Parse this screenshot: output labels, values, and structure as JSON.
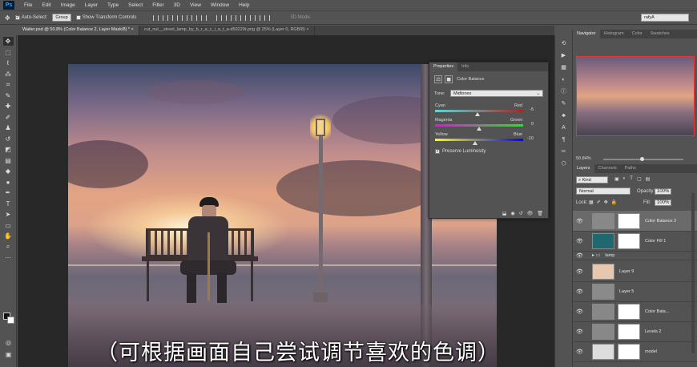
{
  "app": {
    "logo": "Ps"
  },
  "menu": [
    "File",
    "Edit",
    "Image",
    "Layer",
    "Type",
    "Select",
    "Filter",
    "3D",
    "View",
    "Window",
    "Help"
  ],
  "options": {
    "auto_select": "Auto-Select:",
    "group": "Group",
    "transform": "Show Transform Controls",
    "mode3d": "3D Mode:",
    "workspace": "rafyA"
  },
  "tabs": [
    {
      "label": "Waiter.psd @ 50.8% (Color Balance 2, Layer Mask/8) *"
    },
    {
      "label": "cut_out__street_lamp_by_b_r_a_c_i_a_t_a-d59229t.png @ 25% (Layer 0, RGB/8)"
    }
  ],
  "navigator": {
    "tabs": [
      "Navigator",
      "Histogram",
      "Color",
      "Swatches"
    ],
    "zoom": "50.84%"
  },
  "properties": {
    "tabs": [
      "Properties",
      "Info"
    ],
    "title": "Color Balance",
    "tone_label": "Tone:",
    "tone_value": "Midtones",
    "sliders": [
      {
        "left": "Cyan",
        "right": "Red",
        "value": "-5",
        "pos": 0.48
      },
      {
        "left": "Magenta",
        "right": "Green",
        "value": "0",
        "pos": 0.5
      },
      {
        "left": "Yellow",
        "right": "Blue",
        "value": "-10",
        "pos": 0.45
      }
    ],
    "preserve": "Preserve Luminosity"
  },
  "layers": {
    "tabs": [
      "Layers",
      "Channels",
      "Paths"
    ],
    "kind": "Kind",
    "blend": "Normal",
    "opacity_label": "Opacity:",
    "opacity": "100%",
    "lock_label": "Lock:",
    "fill_label": "Fill:",
    "fill": "100%",
    "items": [
      {
        "name": "Color Balance 2",
        "thumb": "#888",
        "mask": true,
        "selected": true
      },
      {
        "name": "Color Fill 1",
        "thumb": "#1f6870",
        "mask": true,
        "selected": false
      },
      {
        "name": "lamp",
        "thumb": "",
        "mask": false,
        "selected": false,
        "group": true
      },
      {
        "name": "Layer 9",
        "thumb": "#e6c8b0",
        "mask": false,
        "selected": false
      },
      {
        "name": "Layer 5",
        "thumb": "#8a8a8a",
        "mask": false,
        "selected": false
      },
      {
        "name": "Color Bala...",
        "thumb": "#888",
        "mask": true,
        "selected": false
      },
      {
        "name": "Levels 2",
        "thumb": "#888",
        "mask": true,
        "selected": false
      },
      {
        "name": "model",
        "thumb": "#ddd",
        "mask": true,
        "selected": false
      }
    ]
  },
  "subtitle": "（可根据画面自己尝试调节喜欢的色调）"
}
